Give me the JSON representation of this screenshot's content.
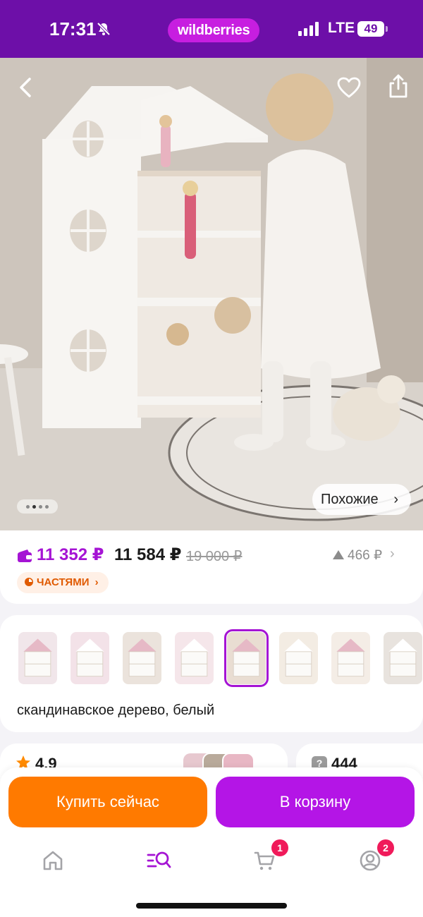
{
  "status_bar": {
    "time": "17:31",
    "brand": "wildberries",
    "network": "LTE",
    "battery": "49"
  },
  "hero": {
    "similar_label": "Похожие",
    "photo_count": 4,
    "current_photo": 2,
    "icons": [
      "back-arrow-icon",
      "heart-icon",
      "share-icon"
    ]
  },
  "price": {
    "wallet_price": "11 352 ₽",
    "current_price": "11 584 ₽",
    "old_price": "19 000 ₽",
    "price_change": "466 ₽",
    "installments_label": "ЧАСТЯМИ"
  },
  "variants": {
    "selected_index": 4,
    "selected_label": "скандинавское дерево, белый",
    "thumb_colors": [
      "#f1e6ea",
      "#f3e2e8",
      "#ebe3dc",
      "#f5e6ea",
      "#e9ddd2",
      "#f3ece3",
      "#f4ede6",
      "#e8e3de"
    ]
  },
  "rating": {
    "value": "4.9"
  },
  "questions": {
    "count": "444"
  },
  "actions": {
    "buy_now": "Купить сейчас",
    "add_to_cart": "В корзину"
  },
  "nav": {
    "cart_badge": "1",
    "profile_badge": "2",
    "active_color": "#a514d4"
  },
  "colors": {
    "status_bar": "#6d0fa8",
    "brand_pill": "#c71ee0",
    "buy_button": "#ff7a00",
    "cart_button": "#b415e6",
    "wallet_price": "#a514d4",
    "badge": "#f01a5a"
  }
}
